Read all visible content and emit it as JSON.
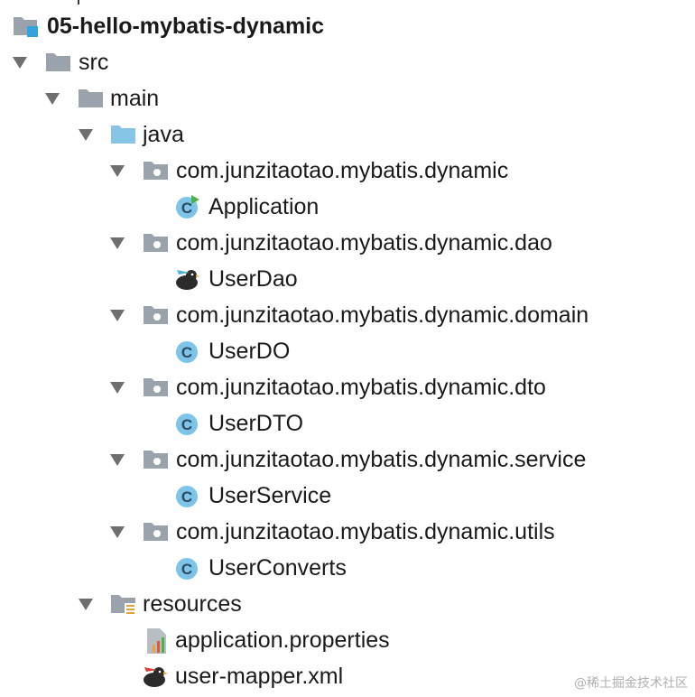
{
  "project": {
    "name": "05-hello-mybatis-dynamic",
    "icon": "module-folder-icon"
  },
  "tree": {
    "src": "src",
    "main": "main",
    "java": "java",
    "packages": [
      {
        "name": "com.junzitaotao.mybatis.dynamic",
        "files": [
          {
            "name": "Application",
            "icon": "runnable-class-icon"
          }
        ]
      },
      {
        "name": "com.junzitaotao.mybatis.dynamic.dao",
        "files": [
          {
            "name": "UserDao",
            "icon": "mybatis-bird-icon"
          }
        ]
      },
      {
        "name": "com.junzitaotao.mybatis.dynamic.domain",
        "files": [
          {
            "name": "UserDO",
            "icon": "class-icon"
          }
        ]
      },
      {
        "name": "com.junzitaotao.mybatis.dynamic.dto",
        "files": [
          {
            "name": "UserDTO",
            "icon": "class-icon"
          }
        ]
      },
      {
        "name": "com.junzitaotao.mybatis.dynamic.service",
        "files": [
          {
            "name": "UserService",
            "icon": "class-icon"
          }
        ]
      },
      {
        "name": "com.junzitaotao.mybatis.dynamic.utils",
        "files": [
          {
            "name": "UserConverts",
            "icon": "class-icon"
          }
        ]
      }
    ],
    "resources": "resources",
    "resource_files": [
      {
        "name": "application.properties",
        "icon": "properties-file-icon"
      },
      {
        "name": "user-mapper.xml",
        "icon": "mybatis-mapper-icon"
      }
    ]
  },
  "watermark": "@稀土掘金技术社区",
  "colors": {
    "folder_gray": "#9aa3ab",
    "source_folder_blue": "#86c5e6",
    "class_circle": "#7ec4e8",
    "arrow": "#6e6e6e"
  }
}
